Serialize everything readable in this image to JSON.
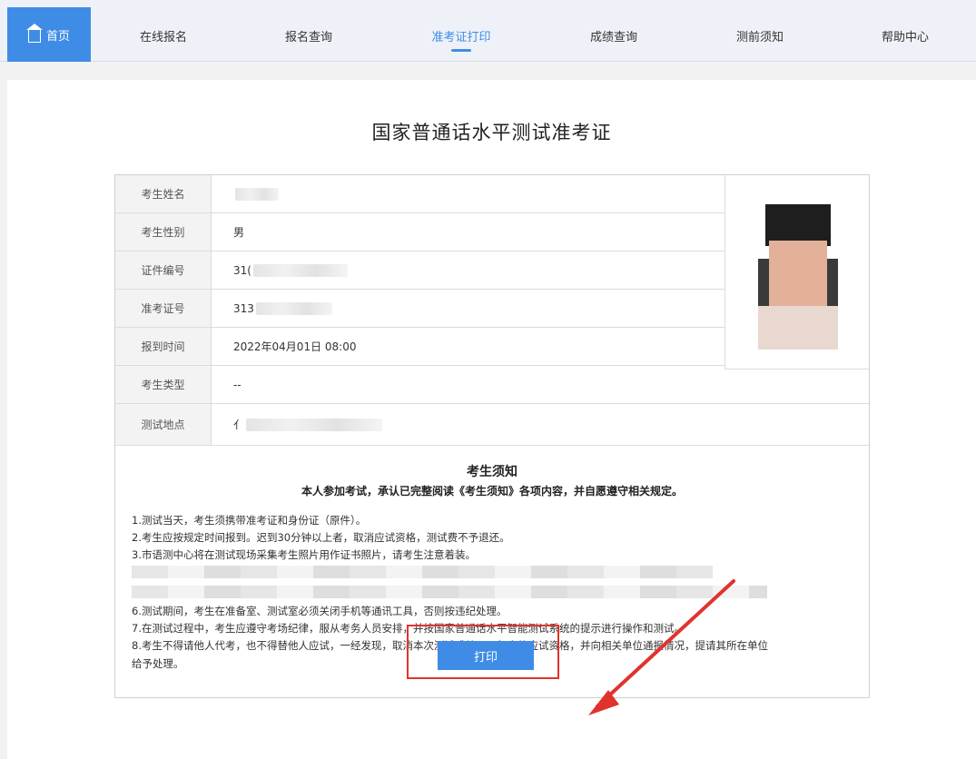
{
  "nav": {
    "home": "首页",
    "items": [
      "在线报名",
      "报名查询",
      "准考证打印",
      "成绩查询",
      "测前须知",
      "帮助中心"
    ],
    "active_index": 2
  },
  "page_title": "国家普通话水平测试准考证",
  "fields": [
    {
      "label": "考生姓名",
      "value": ""
    },
    {
      "label": "考生性别",
      "value": "男"
    },
    {
      "label": "证件编号",
      "value": "31("
    },
    {
      "label": "准考证号",
      "value": "313"
    },
    {
      "label": "报到时间",
      "value": "2022年04月01日 08:00"
    },
    {
      "label": "考生类型",
      "value": "--"
    },
    {
      "label": "测试地点",
      "value": "亻"
    }
  ],
  "notice": {
    "heading": "考生须知",
    "subheading": "本人参加考试，承认已完整阅读《考生须知》各项内容，并自愿遵守相关规定。",
    "lines": [
      "1.测试当天，考生须携带准考证和身份证（原件）。",
      "2.考生应按规定时间报到。迟到30分钟以上者，取消应试资格，测试费不予退还。",
      "3.市语测中心将在测试现场采集考生照片用作证书照片，请考生注意着装。",
      "6.测试期间，考生在准备室、测试室必须关闭手机等通讯工具，否则按违纪处理。",
      "7.在测试过程中，考生应遵守考场纪律，服从考务人员安排，并按国家普通话水平智能测试系统的提示进行操作和测试。",
      "8.考生不得请他人代考，也不得替他人应试，一经发现，取消本次测试成绩及一年内的应试资格，并向相关单位通报情况，提请其所在单位",
      "给予处理。"
    ]
  },
  "print_label": "打印",
  "colors": {
    "accent": "#3f8ce6",
    "highlight": "#e0332d"
  }
}
